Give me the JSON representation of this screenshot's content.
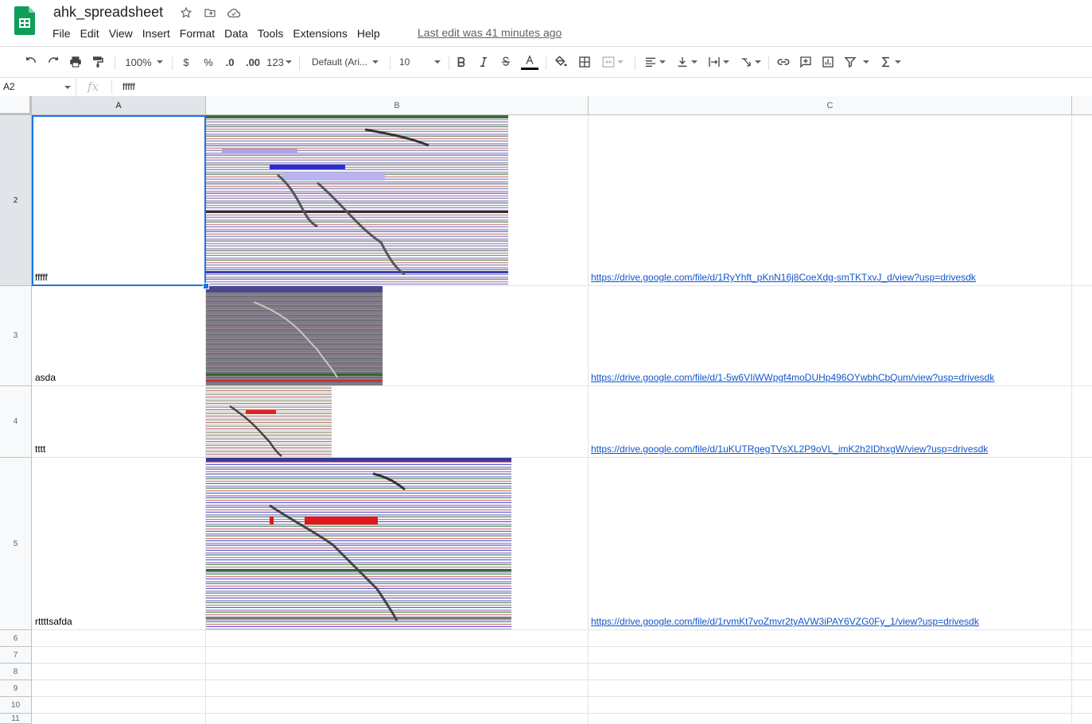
{
  "header": {
    "title": "ahk_spreadsheet",
    "last_edit": "Last edit was 41 minutes ago",
    "brand_color": "#0f9d58"
  },
  "menu": [
    "File",
    "Edit",
    "View",
    "Insert",
    "Format",
    "Data",
    "Tools",
    "Extensions",
    "Help"
  ],
  "toolbar": {
    "zoom": "100%",
    "currency": "$",
    "percent": "%",
    "decrease_decimal": ".0",
    "increase_decimal": ".00",
    "more_formats": "123",
    "font": "Default (Ari...",
    "font_size": "10",
    "text_color": "#000000"
  },
  "formula": {
    "name_box": "A2",
    "fx": "fx",
    "value": "fffff"
  },
  "columns": [
    "A",
    "B",
    "C"
  ],
  "row_numbers": [
    "2",
    "3",
    "4",
    "5",
    "6",
    "7",
    "8",
    "9",
    "10",
    "11"
  ],
  "rows": [
    {
      "a": "fffff",
      "c": "https://drive.google.com/file/d/1RyYhft_pKnN16j8CoeXdg-smTKTxvJ_d/view?usp=drivesdk"
    },
    {
      "a": "asda",
      "c": "https://drive.google.com/file/d/1-5w6VIiWWpgf4moDUHp496OYwbhCbQum/view?usp=drivesdk"
    },
    {
      "a": "tttt",
      "c": "https://drive.google.com/file/d/1uKUTRgegTVsXL2P9oVL_imK2h2IDhxgW/view?usp=drivesdk"
    },
    {
      "a": "rttttsafda",
      "c": "https://drive.google.com/file/d/1rvmKt7voZmvr2tyAVW3iPAY6VZG0Fy_1/view?usp=drivesdk"
    }
  ],
  "colors": {
    "selection": "#1a73e8",
    "link": "#1155cc"
  }
}
